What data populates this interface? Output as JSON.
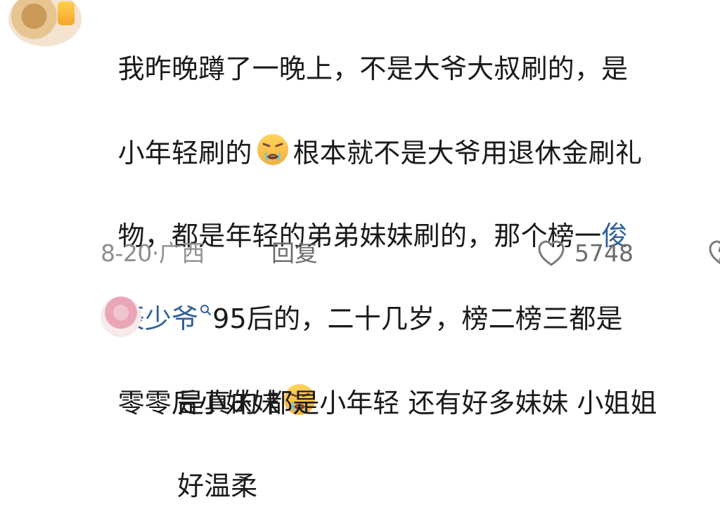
{
  "comment": {
    "text_line_1": "我昨晚蹲了一晚上，不是大爷大叔刷的，是",
    "text_line_2_prefix": "小年轻刷的",
    "text_line_2_suffix": "根本就不是大爷用退休金刷礼",
    "text_line_3_prefix": "物，都是年轻的弟弟妹妹刷的，那个榜一",
    "mention_part_1": "俊",
    "mention_part_2": "辰少爷",
    "text_line_4_suffix": "95后的，二十几岁，榜二榜三都是",
    "text_line_5_prefix": "零零后小妹妹",
    "meta": {
      "date_location": "8-20·广西",
      "reply_label": "回复",
      "like_count": "5748"
    }
  },
  "reply": {
    "username": "",
    "text_line_1": "是真的 都是小年轻 还有好多妹妹 小姐姐",
    "text_line_2": "好温柔"
  },
  "icons": {
    "emoji": "loudly-crying-face-emoji",
    "mention_search": "search-icon",
    "like": "heart-icon",
    "dislike": "broken-heart-icon"
  },
  "colors": {
    "text": "#1a1a1a",
    "mention": "#2f5f99",
    "meta": "#8f8f8f",
    "icon": "#6c6c6c"
  }
}
